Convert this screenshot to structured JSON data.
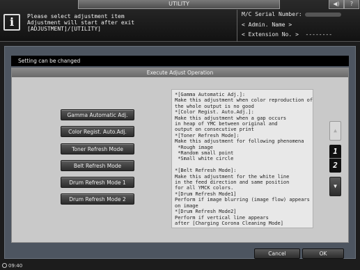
{
  "topbar": {
    "tab_label": "UTILITY",
    "volume_icon": "speaker-icon",
    "help_label": "?",
    "message_lines": [
      "Please select adjustment item",
      "Adjustment will start after exit",
      "[ADJUSTMENT]/[UTILITY]"
    ],
    "serial_label": "M/C Serial Number:",
    "admin_label": "< Admin. Name >",
    "extension_label": "< Extension No. >  --------"
  },
  "status_text": "Setting can be changed",
  "dialog": {
    "title": "Execute Adjust Operation",
    "buttons": [
      "Gamma Automatic Adj.",
      "Color Regist. Auto.Adj.",
      "Toner Refresh Mode",
      "Belt Refresh Mode",
      "Drum Refresh Mode 1",
      "Drum Refresh Mode 2"
    ],
    "description_lines": [
      "*[Gamma Automatic Adj.]:",
      "Make this adjustment when color reproduction of",
      "the whole output is no good",
      "*[Color Regist. Auto.Adj.]:",
      "Make this adjustment when a gap occurs",
      "in heap of YMC between original and",
      "output on consecutive print",
      "*[Toner Refresh Mode]:",
      "Make this adjustment for following phenomena",
      " *Rough image",
      " *Random small point",
      " *Small white circle",
      "",
      "*[Belt Refresh Mode]:",
      "Make this adjustment for the white line",
      "in the feed direction and same position",
      "for all YMCK colors.",
      "*[Drum Refresh Mode1]",
      "Perform if image blurring (image flow) appears",
      "on image",
      "*[Drum Refresh Mode2]",
      "Perform if vertical line appears",
      "after [Charging Corona Cleaning Mode]"
    ],
    "scroll_up": "▲",
    "scroll_down": "▼",
    "page_current": "1",
    "page_total": "2"
  },
  "footer": {
    "cancel_label": "Cancel",
    "ok_label": "OK",
    "time": "09:40"
  }
}
